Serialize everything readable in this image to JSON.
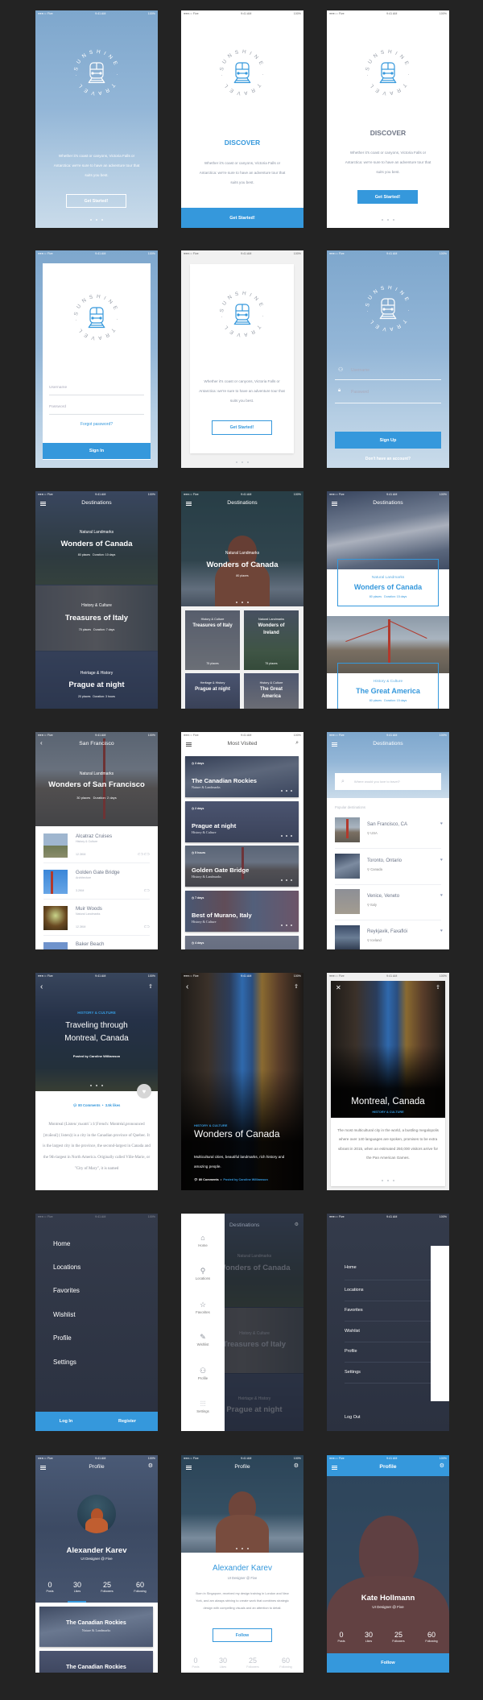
{
  "status": {
    "carrier": "●●●○○ Five",
    "time": "9:41 AM",
    "battery": "100%"
  },
  "logo": {
    "ring_text": "SUNSHINE · TRAVEL ·"
  },
  "colors": {
    "accent": "#3598dc",
    "dark_bg": "#2e3545",
    "page_bg": "#232323"
  },
  "intro_text": "Whether it's coast or canyons, Victoria Falls or Antarctica: we're sure to have an adventure tour that suits you best.",
  "screens": {
    "splash": {
      "button": "Get Started!"
    },
    "discover_blue": {
      "title": "DISCOVER",
      "button": "Get Started!"
    },
    "discover_gray": {
      "title": "DISCOVER",
      "button": "Get Started!"
    },
    "signin": {
      "username_placeholder": "Username",
      "password_placeholder": "Password",
      "forgot": "Forgot password?",
      "button": "Sign In"
    },
    "card_intro": {
      "button": "Get Started!"
    },
    "signup": {
      "username_placeholder": "Username",
      "password_placeholder": "Password",
      "button": "Sign Up",
      "footer_link": "Don't have an account?"
    },
    "destinations": {
      "title": "Destinations",
      "items": [
        {
          "category": "Natural Landmarks",
          "title": "Wonders of Canada",
          "places": "80 places",
          "duration": "Duration: 10 days"
        },
        {
          "category": "History & Culture",
          "title": "Treasures of Italy",
          "places": "75 places",
          "duration": "Duration: 7 days"
        },
        {
          "category": "Heirtage & History",
          "title": "Prague at night",
          "places": "20 places",
          "duration": "Duration: 3 hours"
        }
      ]
    },
    "destinations_grid": {
      "title": "Destinations",
      "hero": {
        "category": "Natural Landmarks",
        "title": "Wonders of Canada",
        "places": "80 places"
      },
      "tiles": [
        {
          "category": "History & Culture",
          "title": "Treasures of Italy",
          "places": "75 places"
        },
        {
          "category": "Natural Landmarks",
          "title": "Wonders of Ireland",
          "places": "75 places"
        },
        {
          "category": "Heritage & History",
          "title": "Prague at night"
        },
        {
          "category": "History & Culture",
          "title": "The Great America"
        }
      ]
    },
    "destinations_boxed": {
      "title": "Destinations",
      "items": [
        {
          "category": "Natural Landmarks",
          "title": "Wonders of Canada",
          "places": "80 places",
          "duration": "Duration: 15 days"
        },
        {
          "category": "History & Culture",
          "title": "The Great America",
          "places": "80 places",
          "duration": "Duration: 15 days"
        }
      ]
    },
    "city": {
      "title": "San Francisco",
      "category": "Natural Landmarks",
      "headline": "Wonders of San Francisco",
      "places": "30 places",
      "duration": "Duration: 2 days",
      "items": [
        {
          "title": "Alcatraz Cruises",
          "category": "History & Culture",
          "distance": "12.3KM"
        },
        {
          "title": "Golden Gate Bridge",
          "category": "Architecture",
          "distance": "3.2KM"
        },
        {
          "title": "Muir Woods",
          "category": "Natural Landmarks",
          "distance": "12.3KM"
        },
        {
          "title": "Baker Beach"
        }
      ]
    },
    "most_visited": {
      "title": "Most Visited",
      "cards": [
        {
          "duration": "3 days",
          "title": "The Canadian Rockies",
          "subtitle": "Nature & Landmarks"
        },
        {
          "duration": "2 days",
          "title": "Prague at night",
          "subtitle": "History & Culture"
        },
        {
          "duration": "5 hours",
          "title": "Golden Gate Bridge",
          "subtitle": "History & Landmarks"
        },
        {
          "duration": "7 days",
          "title": "Best of Murano, Italy",
          "subtitle": "History & Culture"
        },
        {
          "duration": "4 days"
        }
      ]
    },
    "search": {
      "title": "Destinations",
      "placeholder": "Where would you love to travel?",
      "section": "Popular destinations",
      "items": [
        {
          "title": "San Francisco, CA",
          "country": "USA"
        },
        {
          "title": "Toronto, Ontario",
          "country": "Canada"
        },
        {
          "title": "Venice, Veneto",
          "country": "Italy"
        },
        {
          "title": "Reykjavik, Faxaflói",
          "country": "Iceland"
        }
      ]
    },
    "article": {
      "category": "HISTORY & CULTURE",
      "title_line1": "Traveling through",
      "title_line2": "Montreal, Canada",
      "author": "Posted by Caroline Williamson",
      "comments": "80 Comments",
      "likes": "3.5k likes",
      "body": "Montreal (Listen/ˌmʌntriˈɔːl/;French: Montréal,pronounced [mɔ̃ʁeal] ( listen)) is a city in the Canadian province of Quebec. It is the largest city in the province, the second-largest in Canada and the 9th-largest in North America. Originally called Ville-Marie, or \"City of Mary\", it is named"
    },
    "article_dark": {
      "category": "HISTORY & CULTURE",
      "title": "Wonders of Canada",
      "text": "Multicultural cities, beautiful landmarks, rich history and amazing people.",
      "comments": "80 Comments",
      "author": "Posted by Caroline Williamson"
    },
    "article_card": {
      "title": "Montreal, Canada",
      "category": "HISTORY & CULTURE",
      "text": "The most multicultural city in the world, a bustling megalopolis where over 140 languages are spoken, promises to be extra vibrant in 2015, when an estimated 250,000 visitors arrive for the Pan American Games."
    },
    "menu_full": {
      "items": [
        "Home",
        "Locations",
        "Favorites",
        "Wishlist",
        "Profile",
        "Settings"
      ],
      "login": "Log In",
      "register": "Register"
    },
    "menu_icons": {
      "items": [
        "Home",
        "Locations",
        "Favorites",
        "Wishlist",
        "Profile",
        "Settings"
      ],
      "background_title": "Destinations"
    },
    "menu_panel": {
      "items": [
        "Home",
        "Locations",
        "Favorites",
        "Wishlist",
        "Profile",
        "Settings"
      ],
      "logout": "Log Out"
    },
    "profile": {
      "title": "Profile",
      "name": "Alexander Karev",
      "role": "UI Designer @ Five",
      "stats": [
        {
          "value": "0",
          "label": "Posts"
        },
        {
          "value": "30",
          "label": "Likes"
        },
        {
          "value": "25",
          "label": "Followers"
        },
        {
          "value": "60",
          "label": "Following"
        }
      ],
      "cards": [
        {
          "title": "The Canadian Rockies",
          "subtitle": "Nature & Landmarks"
        },
        {
          "title": "The Canadian Rockies"
        }
      ]
    },
    "profile_bio": {
      "title": "Profile",
      "name": "Alexander Karev",
      "role": "UI Designer @ Five",
      "bio": "Born in Singapore, received my design training in London and New York, and am always striving to create work that combines strategic design with compelling visuals and an attention to detail.",
      "button": "Follow"
    },
    "profile_photo": {
      "title": "Profile",
      "name": "Kate Hollmann",
      "role": "UI Designer @ Five",
      "button": "Follow"
    }
  }
}
